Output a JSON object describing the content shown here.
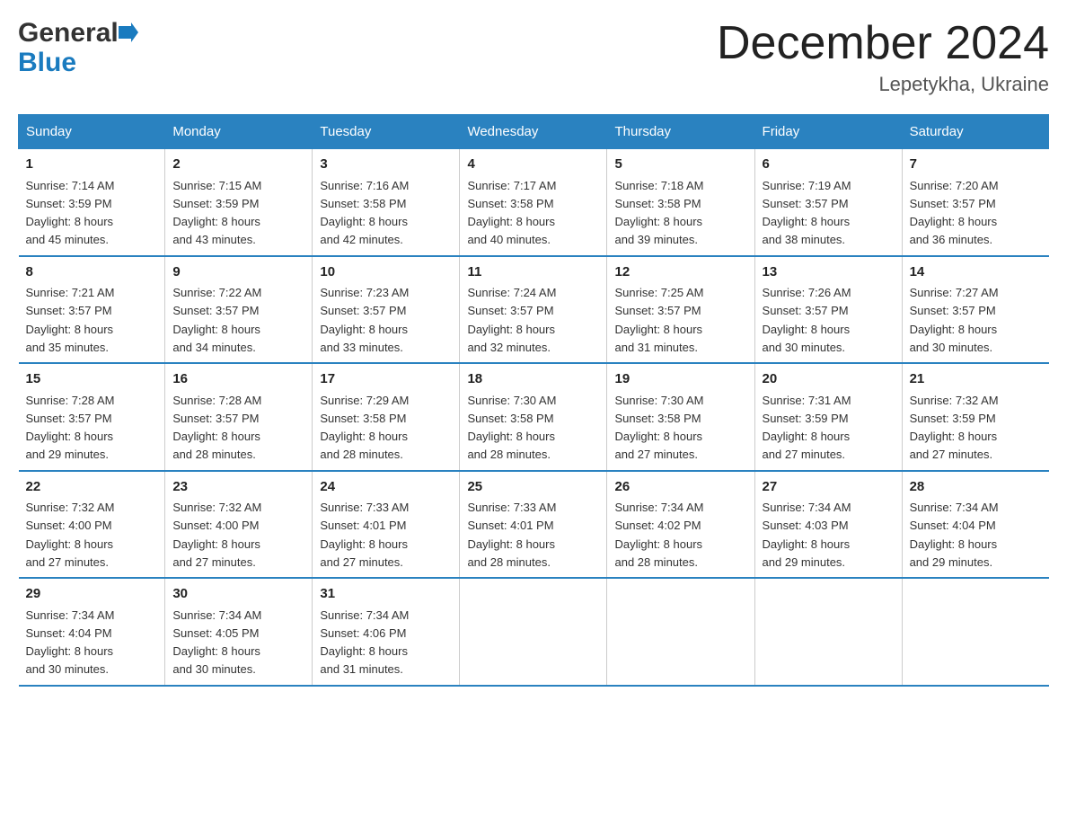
{
  "header": {
    "logo_line1": "General",
    "logo_line2": "Blue",
    "month_title": "December 2024",
    "location": "Lepetykha, Ukraine"
  },
  "days_of_week": [
    "Sunday",
    "Monday",
    "Tuesday",
    "Wednesday",
    "Thursday",
    "Friday",
    "Saturday"
  ],
  "weeks": [
    [
      {
        "day": "1",
        "sunrise": "7:14 AM",
        "sunset": "3:59 PM",
        "daylight": "8 hours and 45 minutes."
      },
      {
        "day": "2",
        "sunrise": "7:15 AM",
        "sunset": "3:59 PM",
        "daylight": "8 hours and 43 minutes."
      },
      {
        "day": "3",
        "sunrise": "7:16 AM",
        "sunset": "3:58 PM",
        "daylight": "8 hours and 42 minutes."
      },
      {
        "day": "4",
        "sunrise": "7:17 AM",
        "sunset": "3:58 PM",
        "daylight": "8 hours and 40 minutes."
      },
      {
        "day": "5",
        "sunrise": "7:18 AM",
        "sunset": "3:58 PM",
        "daylight": "8 hours and 39 minutes."
      },
      {
        "day": "6",
        "sunrise": "7:19 AM",
        "sunset": "3:57 PM",
        "daylight": "8 hours and 38 minutes."
      },
      {
        "day": "7",
        "sunrise": "7:20 AM",
        "sunset": "3:57 PM",
        "daylight": "8 hours and 36 minutes."
      }
    ],
    [
      {
        "day": "8",
        "sunrise": "7:21 AM",
        "sunset": "3:57 PM",
        "daylight": "8 hours and 35 minutes."
      },
      {
        "day": "9",
        "sunrise": "7:22 AM",
        "sunset": "3:57 PM",
        "daylight": "8 hours and 34 minutes."
      },
      {
        "day": "10",
        "sunrise": "7:23 AM",
        "sunset": "3:57 PM",
        "daylight": "8 hours and 33 minutes."
      },
      {
        "day": "11",
        "sunrise": "7:24 AM",
        "sunset": "3:57 PM",
        "daylight": "8 hours and 32 minutes."
      },
      {
        "day": "12",
        "sunrise": "7:25 AM",
        "sunset": "3:57 PM",
        "daylight": "8 hours and 31 minutes."
      },
      {
        "day": "13",
        "sunrise": "7:26 AM",
        "sunset": "3:57 PM",
        "daylight": "8 hours and 30 minutes."
      },
      {
        "day": "14",
        "sunrise": "7:27 AM",
        "sunset": "3:57 PM",
        "daylight": "8 hours and 30 minutes."
      }
    ],
    [
      {
        "day": "15",
        "sunrise": "7:28 AM",
        "sunset": "3:57 PM",
        "daylight": "8 hours and 29 minutes."
      },
      {
        "day": "16",
        "sunrise": "7:28 AM",
        "sunset": "3:57 PM",
        "daylight": "8 hours and 28 minutes."
      },
      {
        "day": "17",
        "sunrise": "7:29 AM",
        "sunset": "3:58 PM",
        "daylight": "8 hours and 28 minutes."
      },
      {
        "day": "18",
        "sunrise": "7:30 AM",
        "sunset": "3:58 PM",
        "daylight": "8 hours and 28 minutes."
      },
      {
        "day": "19",
        "sunrise": "7:30 AM",
        "sunset": "3:58 PM",
        "daylight": "8 hours and 27 minutes."
      },
      {
        "day": "20",
        "sunrise": "7:31 AM",
        "sunset": "3:59 PM",
        "daylight": "8 hours and 27 minutes."
      },
      {
        "day": "21",
        "sunrise": "7:32 AM",
        "sunset": "3:59 PM",
        "daylight": "8 hours and 27 minutes."
      }
    ],
    [
      {
        "day": "22",
        "sunrise": "7:32 AM",
        "sunset": "4:00 PM",
        "daylight": "8 hours and 27 minutes."
      },
      {
        "day": "23",
        "sunrise": "7:32 AM",
        "sunset": "4:00 PM",
        "daylight": "8 hours and 27 minutes."
      },
      {
        "day": "24",
        "sunrise": "7:33 AM",
        "sunset": "4:01 PM",
        "daylight": "8 hours and 27 minutes."
      },
      {
        "day": "25",
        "sunrise": "7:33 AM",
        "sunset": "4:01 PM",
        "daylight": "8 hours and 28 minutes."
      },
      {
        "day": "26",
        "sunrise": "7:34 AM",
        "sunset": "4:02 PM",
        "daylight": "8 hours and 28 minutes."
      },
      {
        "day": "27",
        "sunrise": "7:34 AM",
        "sunset": "4:03 PM",
        "daylight": "8 hours and 29 minutes."
      },
      {
        "day": "28",
        "sunrise": "7:34 AM",
        "sunset": "4:04 PM",
        "daylight": "8 hours and 29 minutes."
      }
    ],
    [
      {
        "day": "29",
        "sunrise": "7:34 AM",
        "sunset": "4:04 PM",
        "daylight": "8 hours and 30 minutes."
      },
      {
        "day": "30",
        "sunrise": "7:34 AM",
        "sunset": "4:05 PM",
        "daylight": "8 hours and 30 minutes."
      },
      {
        "day": "31",
        "sunrise": "7:34 AM",
        "sunset": "4:06 PM",
        "daylight": "8 hours and 31 minutes."
      },
      null,
      null,
      null,
      null
    ]
  ],
  "labels": {
    "sunrise_prefix": "Sunrise: ",
    "sunset_prefix": "Sunset: ",
    "daylight_prefix": "Daylight: "
  }
}
